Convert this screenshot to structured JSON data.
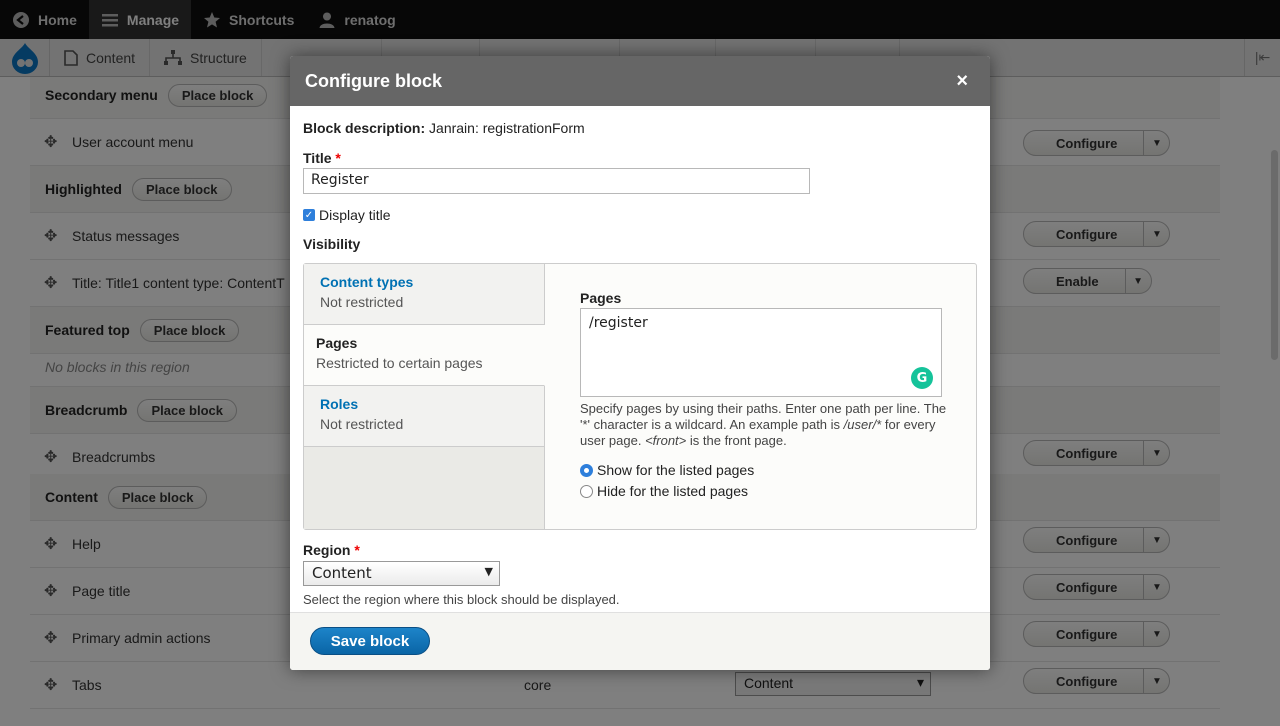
{
  "toolbar": {
    "items": [
      {
        "label": "Home",
        "icon": "home-icon"
      },
      {
        "label": "Manage",
        "icon": "hamburger-icon"
      },
      {
        "label": "Shortcuts",
        "icon": "star-icon"
      },
      {
        "label": "renatog",
        "icon": "user-icon"
      }
    ]
  },
  "tray": {
    "items": [
      {
        "label": "Content",
        "icon": "file-icon"
      },
      {
        "label": "Structure",
        "icon": "structure-icon"
      }
    ]
  },
  "background": {
    "secondary_menu": "Secondary menu",
    "place_block": "Place block",
    "user_account_menu": "User account menu",
    "highlighted": "Highlighted",
    "status_messages": "Status messages",
    "title_block": "Title: Title1 content type: ContentT",
    "featured_top": "Featured top",
    "no_blocks": "No blocks in this region",
    "breadcrumb": "Breadcrumb",
    "breadcrumbs": "Breadcrumbs",
    "content": "Content",
    "help": "Help",
    "page_title": "Page title",
    "primary_admin_actions": "Primary admin actions",
    "tabs": "Tabs",
    "tabs_category": "core",
    "tabs_region": "Content",
    "configure": "Configure",
    "enable": "Enable"
  },
  "dialog": {
    "title": "Configure block",
    "close": "×",
    "block_description_label": "Block description:",
    "block_description_value": "Janrain: registrationForm",
    "title_label": "Title",
    "required": "*",
    "title_value": "Register",
    "display_title_label": "Display title",
    "visibility_label": "Visibility",
    "vtabs": [
      {
        "title": "Content types",
        "summary": "Not restricted"
      },
      {
        "title": "Pages",
        "summary": "Restricted to certain pages"
      },
      {
        "title": "Roles",
        "summary": "Not restricted"
      }
    ],
    "pages_label": "Pages",
    "pages_value": "/register",
    "pages_help_1": "Specify pages by using their paths. Enter one path per line. The '*' character is a wildcard. An example path is",
    "pages_help_user": "/user/*",
    "pages_help_2": "for every user page.",
    "pages_help_front": "<front>",
    "pages_help_3": "is the front page.",
    "radio_show": "Show for the listed pages",
    "radio_hide": "Hide for the listed pages",
    "region_label": "Region",
    "region_value": "Content",
    "region_help": "Select the region where this block should be displayed.",
    "save_label": "Save block"
  }
}
